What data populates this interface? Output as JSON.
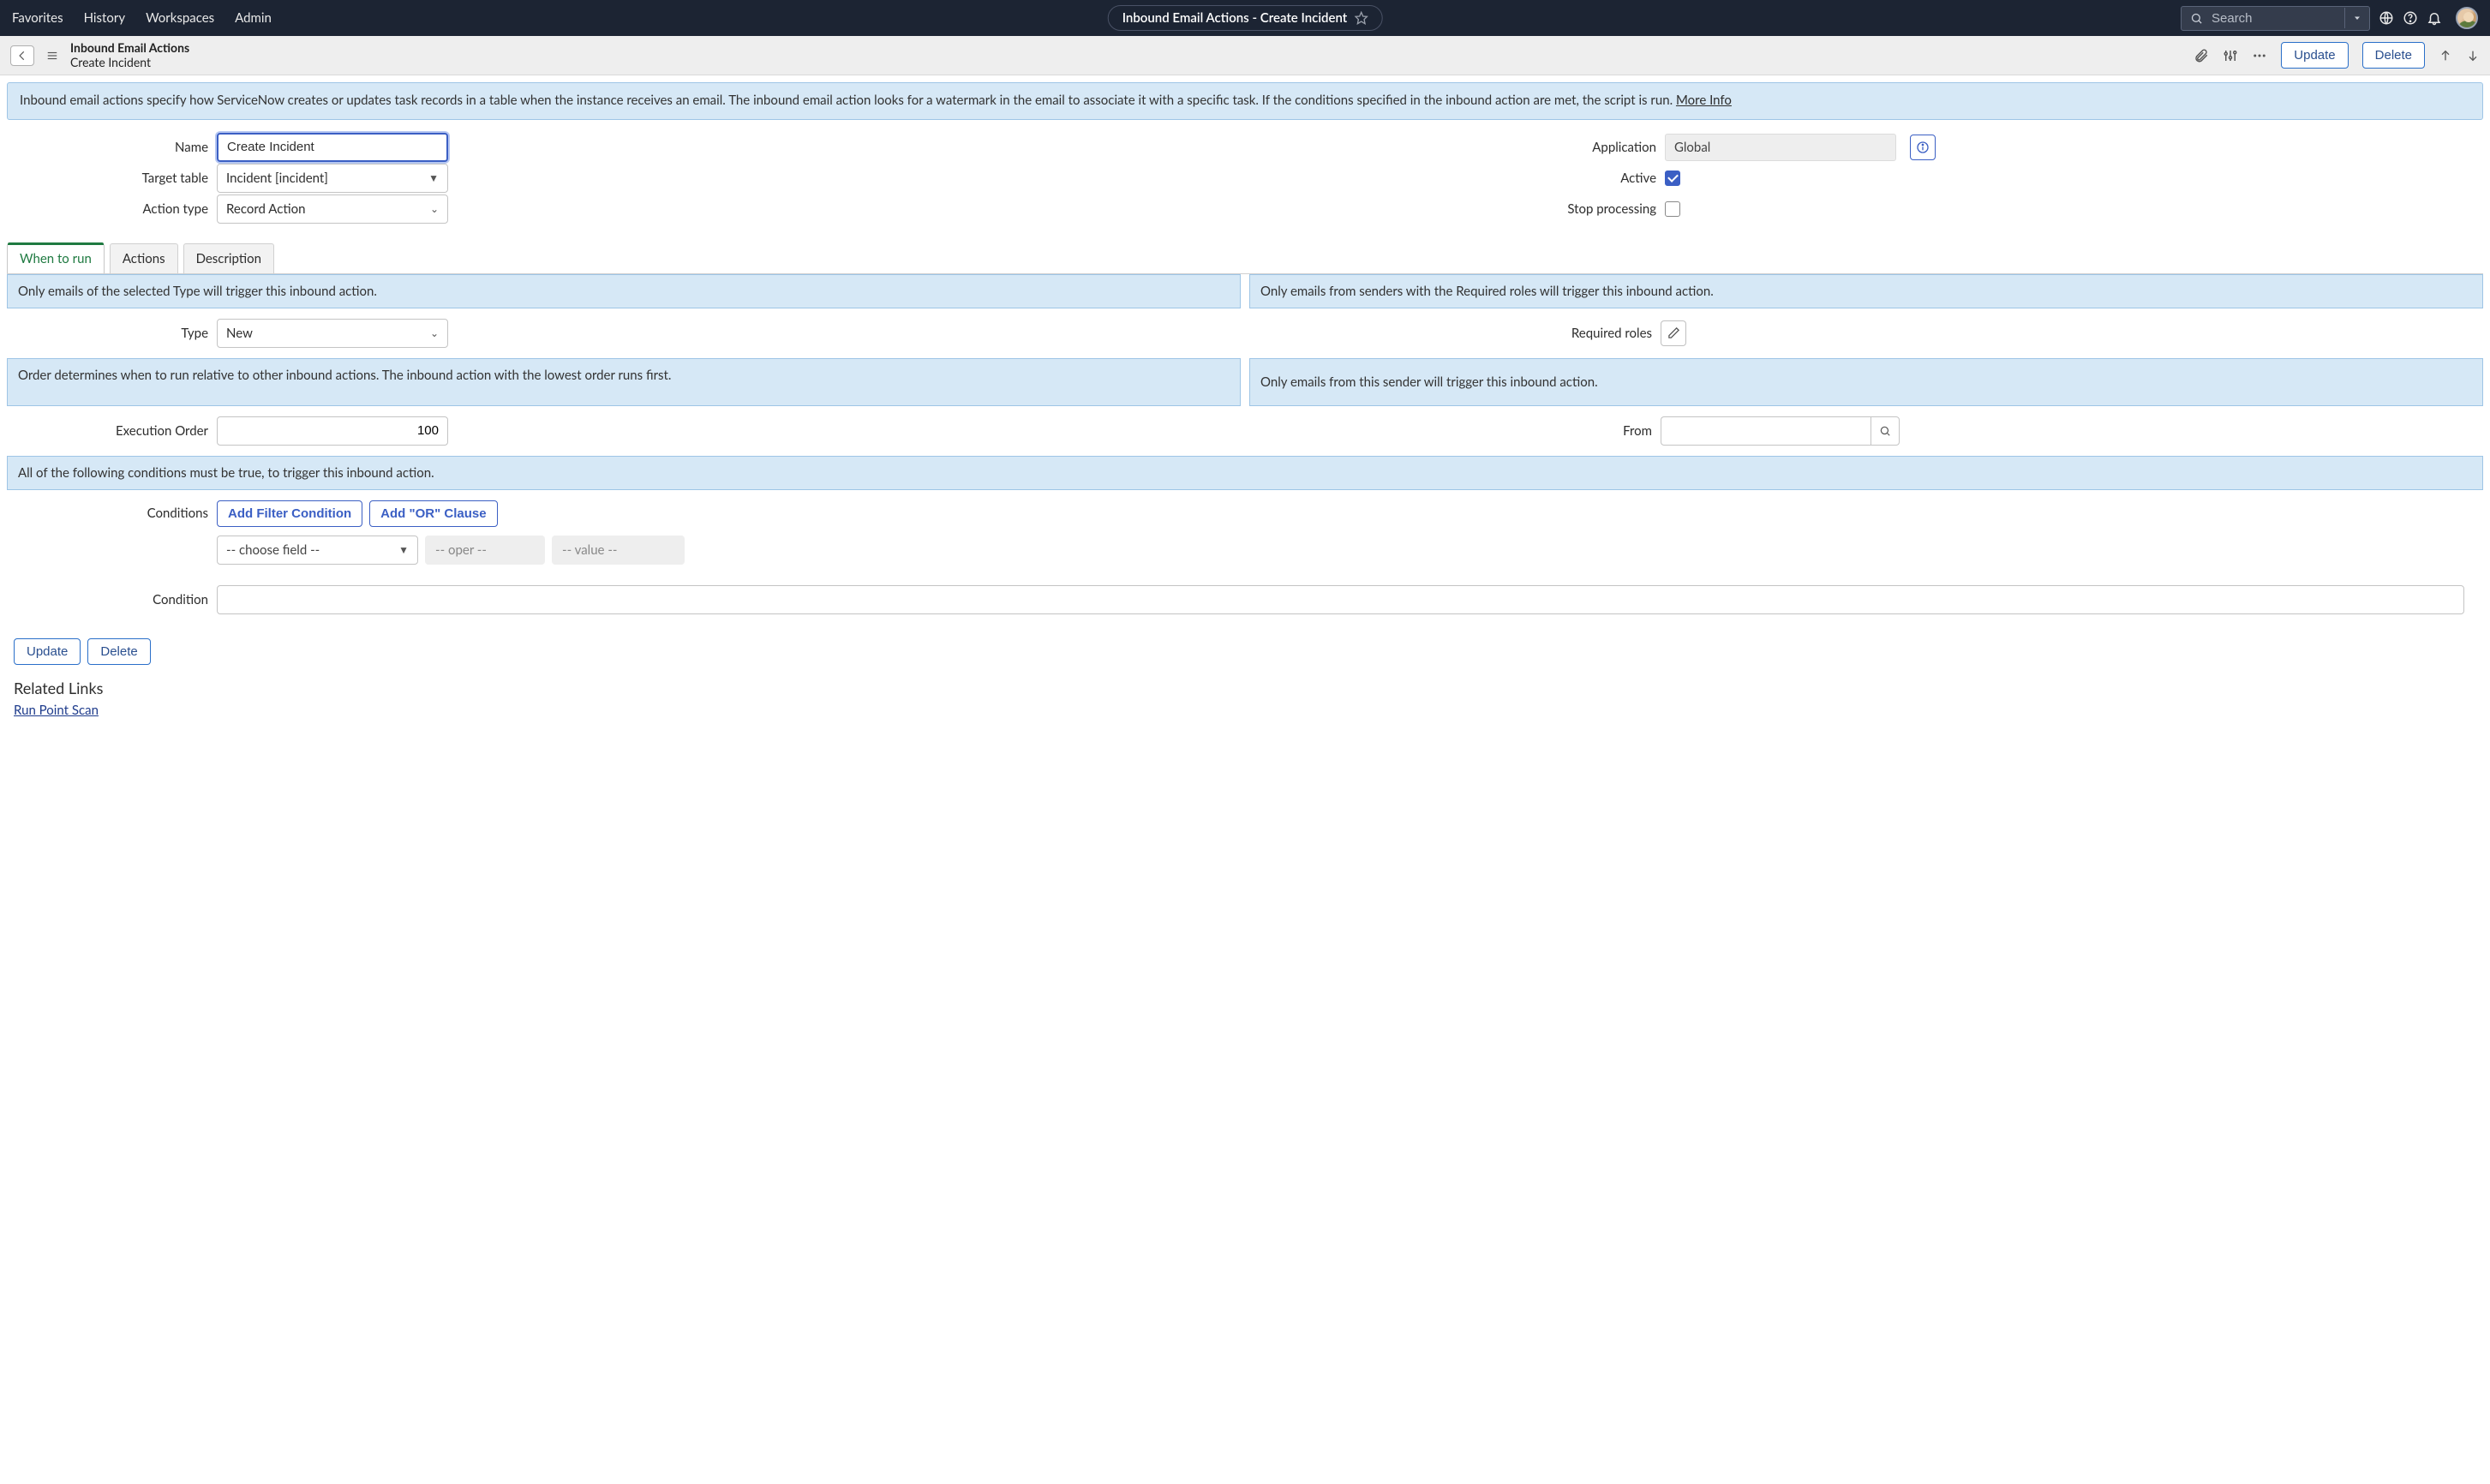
{
  "topnav": {
    "items": [
      "Favorites",
      "History",
      "Workspaces",
      "Admin"
    ],
    "center_title": "Inbound Email Actions - Create Incident",
    "search_placeholder": "Search"
  },
  "subheader": {
    "line1": "Inbound Email Actions",
    "line2": "Create Incident",
    "update": "Update",
    "delete": "Delete"
  },
  "banner": {
    "text": "Inbound email actions specify how ServiceNow creates or updates task records in a table when the instance receives an email. The inbound email action looks for a watermark in the email to associate it with a specific task. If the conditions specified in the inbound action are met, the script is run. ",
    "more_info": "More Info"
  },
  "form": {
    "name_label": "Name",
    "name_value": "Create Incident",
    "target_table_label": "Target table",
    "target_table_value": "Incident [incident]",
    "action_type_label": "Action type",
    "action_type_value": "Record Action",
    "application_label": "Application",
    "application_value": "Global",
    "active_label": "Active",
    "active_checked": true,
    "stop_processing_label": "Stop processing",
    "stop_processing_checked": false
  },
  "tabs": {
    "items": [
      "When to run",
      "Actions",
      "Description"
    ],
    "active_index": 0
  },
  "when_to_run": {
    "type_hint": "Only emails of the selected Type will trigger this inbound action.",
    "roles_hint": "Only emails from senders with the Required roles will trigger this inbound action.",
    "type_label": "Type",
    "type_value": "New",
    "required_roles_label": "Required roles",
    "order_hint": "Order determines when to run relative to other inbound actions. The inbound action with the lowest order runs first.",
    "sender_hint": "Only emails from this sender will trigger this inbound action.",
    "exec_order_label": "Execution Order",
    "exec_order_value": "100",
    "from_label": "From",
    "from_value": "",
    "conditions_hint": "All of the following conditions must be true, to trigger this inbound action.",
    "conditions_label": "Conditions",
    "add_filter": "Add Filter Condition",
    "add_or": "Add \"OR\" Clause",
    "choose_field": "-- choose field --",
    "oper_placeholder": "-- oper --",
    "value_placeholder": "-- value --",
    "condition_label": "Condition",
    "condition_value": ""
  },
  "bottom": {
    "update": "Update",
    "delete": "Delete"
  },
  "related": {
    "heading": "Related Links",
    "run_point_scan": "Run Point Scan"
  }
}
